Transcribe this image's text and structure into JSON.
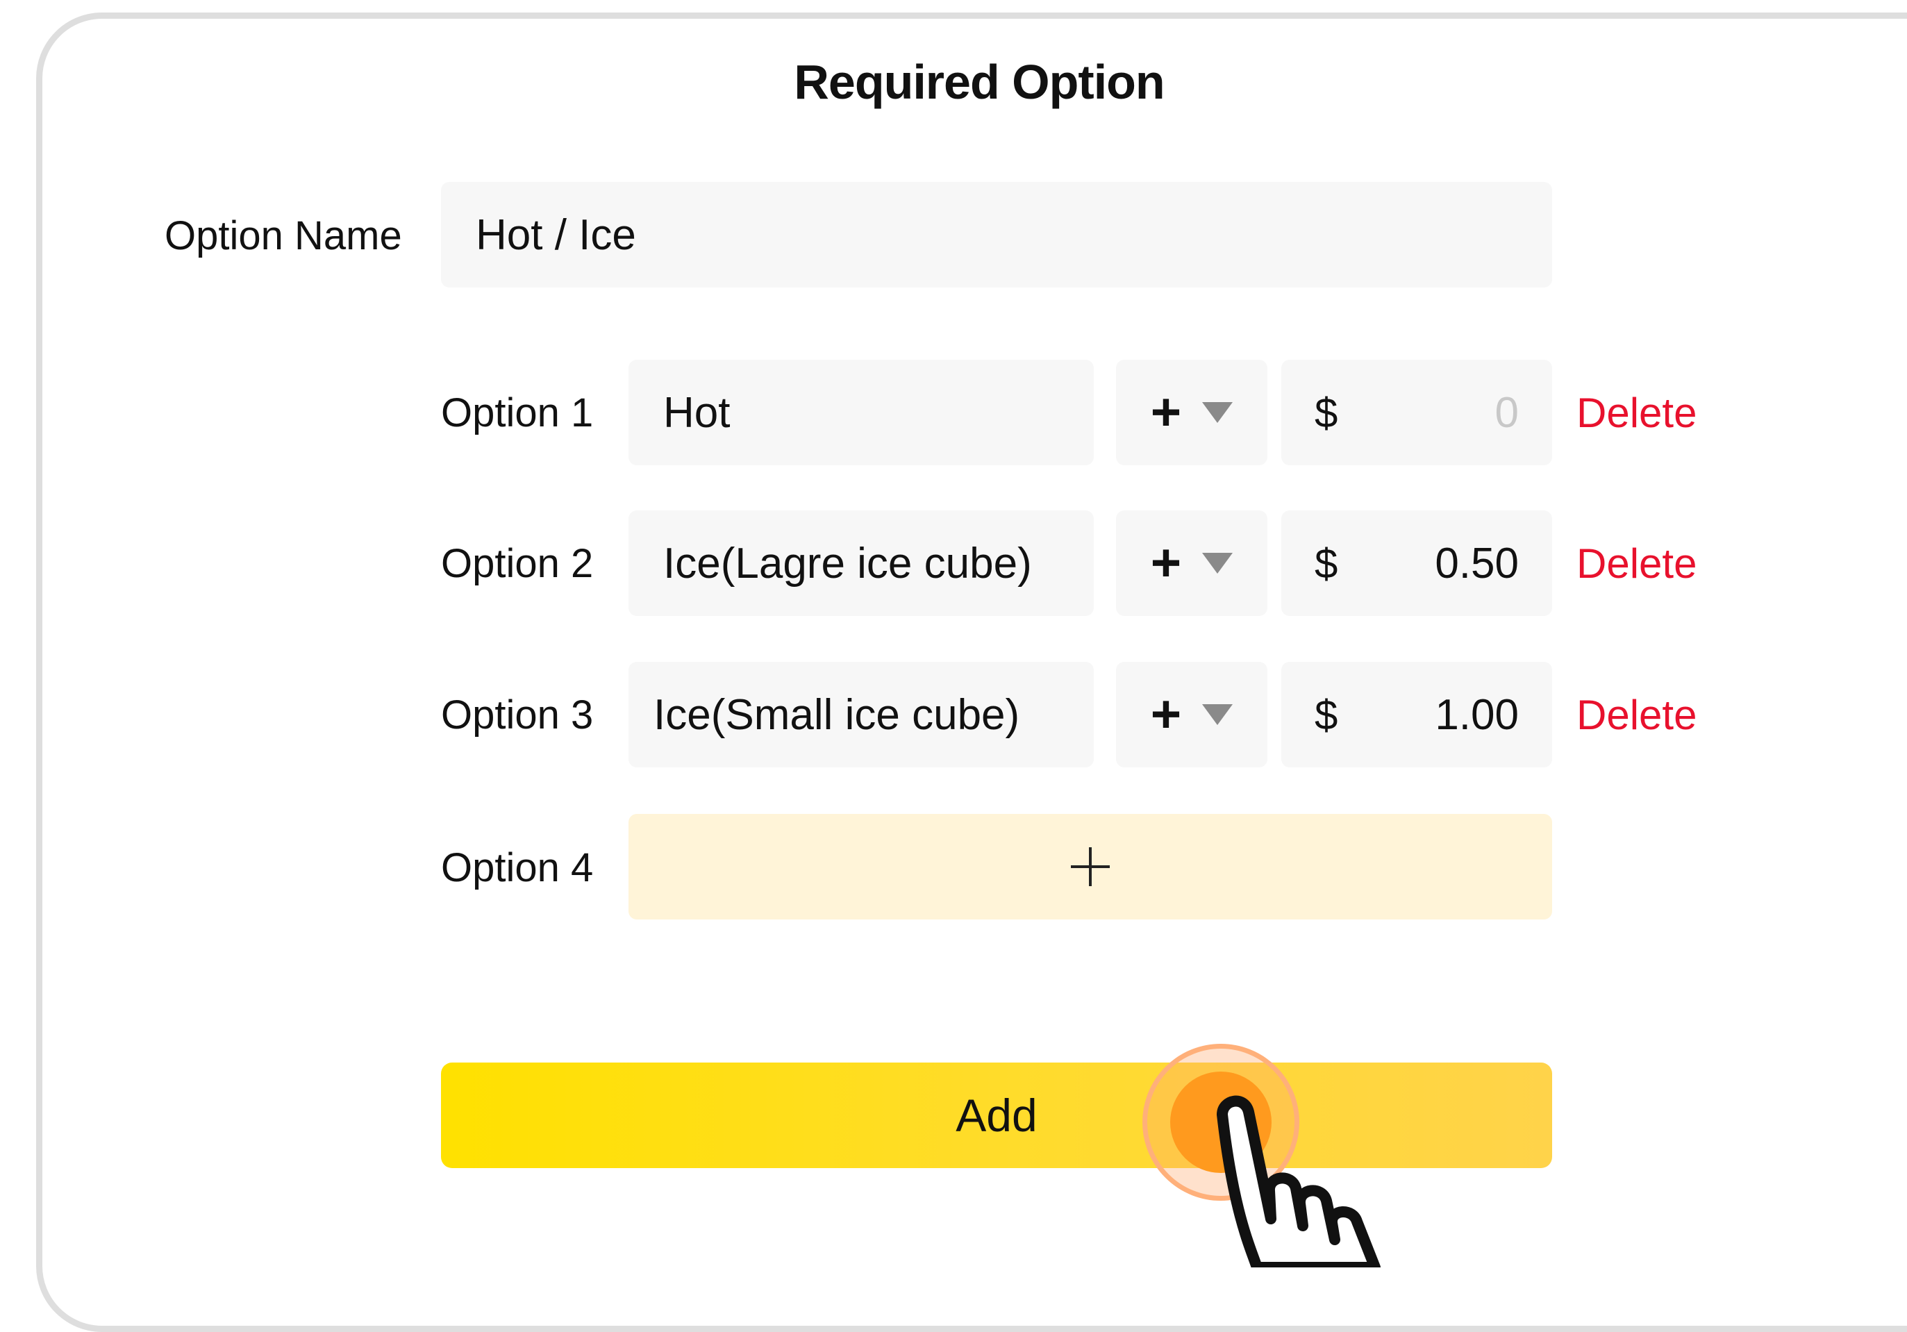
{
  "title": "Required Option",
  "option_name": {
    "label": "Option Name",
    "value": "Hot / Ice"
  },
  "options": [
    {
      "label": "Option 1",
      "name": "Hot",
      "operator": "+",
      "currency": "$",
      "price": "",
      "price_placeholder": "0",
      "delete_label": "Delete"
    },
    {
      "label": "Option 2",
      "name": "Ice(Lagre ice cube)",
      "operator": "+",
      "currency": "$",
      "price": "0.50",
      "price_placeholder": "0",
      "delete_label": "Delete"
    },
    {
      "label": "Option 3",
      "name": "Ice(Small ice cube)",
      "operator": "+",
      "currency": "$",
      "price": "1.00",
      "price_placeholder": "0",
      "delete_label": "Delete"
    }
  ],
  "new_option": {
    "label": "Option 4",
    "add_icon": "plus-icon"
  },
  "add_button": {
    "label": "Add"
  },
  "icons": {
    "operator_dropdown": "caret-down-icon",
    "pointer": "hand-pointer-icon"
  },
  "colors": {
    "accent": "#ffe100",
    "delete": "#e8112d",
    "new_option_bg": "#fff4d8",
    "tap": "#ff9a1e"
  }
}
